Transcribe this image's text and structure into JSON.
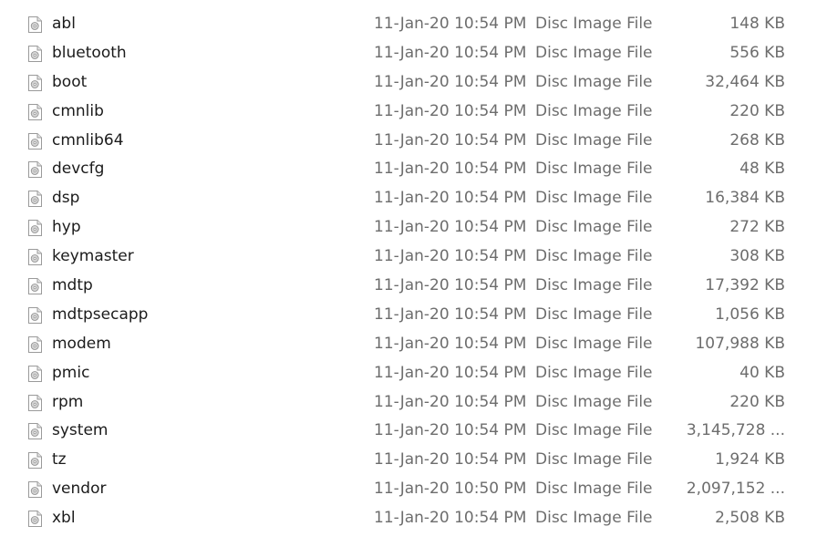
{
  "files": [
    {
      "name": "abl",
      "date": "11-Jan-20 10:54 PM",
      "type": "Disc Image File",
      "size": "148 KB",
      "icon": "disc-image-icon"
    },
    {
      "name": "bluetooth",
      "date": "11-Jan-20 10:54 PM",
      "type": "Disc Image File",
      "size": "556 KB",
      "icon": "disc-image-icon"
    },
    {
      "name": "boot",
      "date": "11-Jan-20 10:54 PM",
      "type": "Disc Image File",
      "size": "32,464 KB",
      "icon": "disc-image-icon"
    },
    {
      "name": "cmnlib",
      "date": "11-Jan-20 10:54 PM",
      "type": "Disc Image File",
      "size": "220 KB",
      "icon": "disc-image-icon"
    },
    {
      "name": "cmnlib64",
      "date": "11-Jan-20 10:54 PM",
      "type": "Disc Image File",
      "size": "268 KB",
      "icon": "disc-image-icon"
    },
    {
      "name": "devcfg",
      "date": "11-Jan-20 10:54 PM",
      "type": "Disc Image File",
      "size": "48 KB",
      "icon": "disc-image-icon"
    },
    {
      "name": "dsp",
      "date": "11-Jan-20 10:54 PM",
      "type": "Disc Image File",
      "size": "16,384 KB",
      "icon": "disc-image-icon"
    },
    {
      "name": "hyp",
      "date": "11-Jan-20 10:54 PM",
      "type": "Disc Image File",
      "size": "272 KB",
      "icon": "disc-image-icon"
    },
    {
      "name": "keymaster",
      "date": "11-Jan-20 10:54 PM",
      "type": "Disc Image File",
      "size": "308 KB",
      "icon": "disc-image-icon"
    },
    {
      "name": "mdtp",
      "date": "11-Jan-20 10:54 PM",
      "type": "Disc Image File",
      "size": "17,392 KB",
      "icon": "disc-image-icon"
    },
    {
      "name": "mdtpsecapp",
      "date": "11-Jan-20 10:54 PM",
      "type": "Disc Image File",
      "size": "1,056 KB",
      "icon": "disc-image-icon"
    },
    {
      "name": "modem",
      "date": "11-Jan-20 10:54 PM",
      "type": "Disc Image File",
      "size": "107,988 KB",
      "icon": "disc-image-icon"
    },
    {
      "name": "pmic",
      "date": "11-Jan-20 10:54 PM",
      "type": "Disc Image File",
      "size": "40 KB",
      "icon": "disc-image-icon"
    },
    {
      "name": "rpm",
      "date": "11-Jan-20 10:54 PM",
      "type": "Disc Image File",
      "size": "220 KB",
      "icon": "disc-image-icon"
    },
    {
      "name": "system",
      "date": "11-Jan-20 10:54 PM",
      "type": "Disc Image File",
      "size": "3,145,728 ...",
      "icon": "disc-image-icon"
    },
    {
      "name": "tz",
      "date": "11-Jan-20 10:54 PM",
      "type": "Disc Image File",
      "size": "1,924 KB",
      "icon": "disc-image-icon"
    },
    {
      "name": "vendor",
      "date": "11-Jan-20 10:50 PM",
      "type": "Disc Image File",
      "size": "2,097,152 ...",
      "icon": "disc-image-icon"
    },
    {
      "name": "xbl",
      "date": "11-Jan-20 10:54 PM",
      "type": "Disc Image File",
      "size": "2,508 KB",
      "icon": "disc-image-icon"
    }
  ]
}
